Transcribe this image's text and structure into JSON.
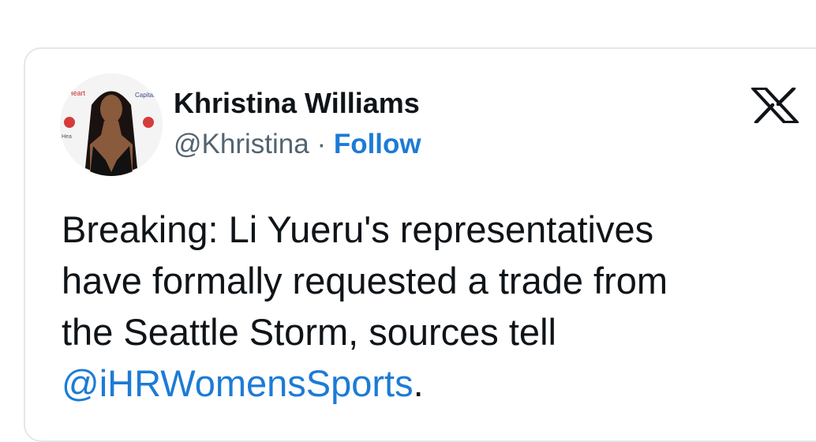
{
  "tweet": {
    "author": {
      "display_name": "Khristina Williams",
      "handle": "@Khristina",
      "separator": "·",
      "follow_label": "Follow",
      "avatar_icon": "profile-photo"
    },
    "platform_icon": "x-logo-icon",
    "text_lines": [
      "Breaking: Li Yueru's representatives",
      "have formally requested a trade from",
      "the Seattle Storm, sources tell"
    ],
    "mention": "@iHRWomensSports",
    "trailing": "."
  },
  "colors": {
    "link": "#1d7bd6",
    "text": "#0f1419",
    "muted": "#536471",
    "border": "#e3e7ea"
  }
}
